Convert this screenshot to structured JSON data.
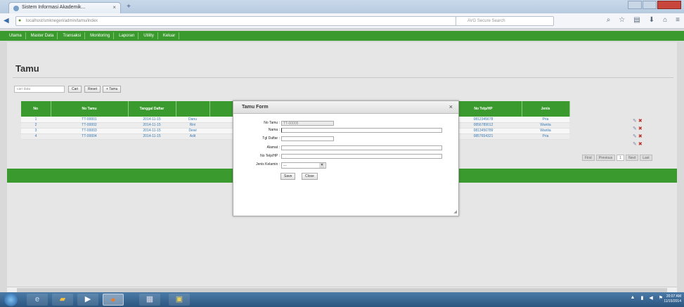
{
  "browser": {
    "tab_title": "Sistem Informasi Akademik...",
    "tab_close": "×",
    "new_tab": "+",
    "url": "localhost/smknegeri/admin/tamu/index",
    "search_placeholder": "AVG Secure Search"
  },
  "menubar": {
    "items": [
      "Utama",
      "Master Data",
      "Transaksi",
      "Monitoring",
      "Laporan",
      "Utility",
      "Keluar"
    ]
  },
  "page": {
    "title": "Tamu",
    "search_placeholder": "cari data",
    "cari_label": "Cari",
    "reset_label": "Reset",
    "add_label": "+ Tamu"
  },
  "table": {
    "headers": [
      "No",
      "No Tamu",
      "Tanggal Daftar",
      "",
      "",
      "No Telp/HP",
      "Jenis"
    ],
    "rows": [
      {
        "no": "1",
        "no_tamu": "TT-00001",
        "tanggal": "2014-11-15",
        "nama": "Danu",
        "telp": "0812345678",
        "jenis": "Pria"
      },
      {
        "no": "2",
        "no_tamu": "TT-00002",
        "tanggal": "2014-11-15",
        "nama": "Rini",
        "telp": "0856789012",
        "jenis": "Wanita"
      },
      {
        "no": "3",
        "no_tamu": "TT-00003",
        "tanggal": "2014-11-15",
        "nama": "Dewi",
        "telp": "0813456789",
        "jenis": "Wanita"
      },
      {
        "no": "4",
        "no_tamu": "TT-00004",
        "tanggal": "2014-11-15",
        "nama": "Adit",
        "telp": "0857654321",
        "jenis": "Pria"
      }
    ],
    "pager": [
      "First",
      "Previous",
      "1",
      "Next",
      "Last"
    ]
  },
  "dialog": {
    "title": "Tamu Form",
    "close": "×",
    "fields": {
      "no_tamu_label": "No Tamu :",
      "no_tamu_value": "TT-00005",
      "nama_label": "Nama :",
      "tgl_label": "Tgl Daftar :",
      "alamat_label": "Alamat :",
      "telp_label": "No Telp/HP :",
      "jk_label": "Jenis Kelamin :",
      "jk_value": "---"
    },
    "save_label": "Save",
    "close_label": "Close"
  },
  "taskbar": {
    "time": "20:07 AM",
    "date": "11/15/2014"
  },
  "colors": {
    "brand_green": "#3a9a2e"
  }
}
